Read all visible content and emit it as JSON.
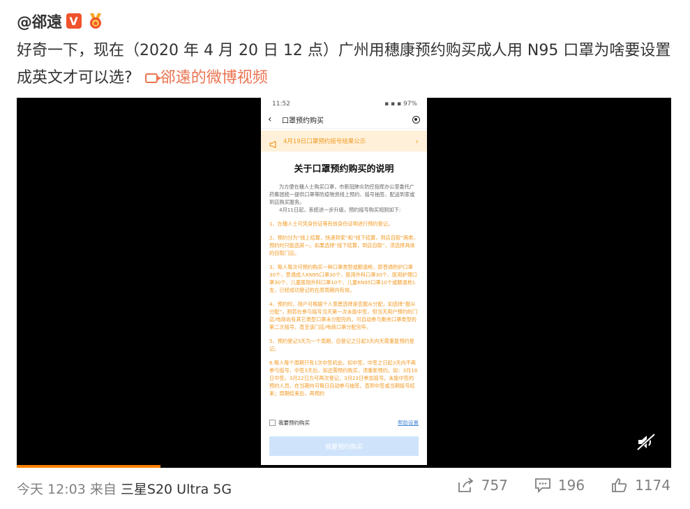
{
  "post": {
    "author": "@郤遠",
    "verified_badge": "V",
    "text": "好奇一下，现在（2020 年 4 月 20 日 12 点）广州用穗康预约购买成人用 N95 口罩为啥要设置成英文才可以选?",
    "video_link": "郤遠的微博视频"
  },
  "video": {
    "progress_percent": 22,
    "phone": {
      "status_time": "11:52",
      "status_battery": "97%",
      "nav_title": "口罩预约购买",
      "notice": "4月19日口罩预约摇号结果公示",
      "heading": "关于口罩预约购买的说明",
      "intro_1": "为方便在穗人士购买口罩，市新冠肺炎防控指挥办公室委托广药集团统一提供口罩等防疫物资线上预约、摇号抽签、配送到家或到店购买服务。",
      "intro_2": "4月11日起，系统进一步升级，预约摇号购买规则如下:",
      "rules": [
        "1、在穗人士可凭身份证等有效身份证明进行预约登记。",
        "2、预约分为“线上结算，快递到家”和“线下结算，到店自取”两类，预约时只能选其一。如果选择“线下结算，到店自取”，须选择具体的自取门店。",
        "3、每人每次可预约购买一种口罩类型或额温枪，即普通防护口罩30个、普通成人KN95口罩30个、医用外科口罩30个、医用护理口罩30个、儿童医用外科口罩10个、儿童KN95口罩10个或额温枪1支，已经成功登记的在原周期内有效。",
        "4、预约时，用户可根据个人意愿选择是否服从分配，如选择“服从分配”，则若在参与摇号当天第一次未能中签，但当天用户预约的门店/电商尚有其它类型口罩未分配完的，可自动参与剩余口罩类型的第二次摇号，直至该门店/电商口罩分配完毕。",
        "5、预约登记3天为一个周期，自登记之日起3天内无需重复预约登记。",
        "6.每人每个周期只有1次中签机会。如中签，中签之日起3天内不再参与摇号，中签3天后，如还需预约购买，须重新预约。如：3月18日中签，3月22日方可再次登记，3月23日参加摇号。未能中签的预约人员，在当期内可每日自动参与抽签，直到中签或当期摇号结束；周期结束后，再预约"
      ],
      "checkbox_label": "我要预约购买",
      "help_link": "帮助设置",
      "submit_button": "我要预约购买"
    }
  },
  "footer": {
    "time": "今天 12:03 来自",
    "device": "三星S20 Ultra 5G",
    "repost_count": "757",
    "comment_count": "196",
    "like_count": "1174"
  },
  "icons": {
    "repost": "share-icon",
    "comment": "comment-icon",
    "like": "thumbs-up-icon",
    "mute": "volume-muted-icon"
  }
}
